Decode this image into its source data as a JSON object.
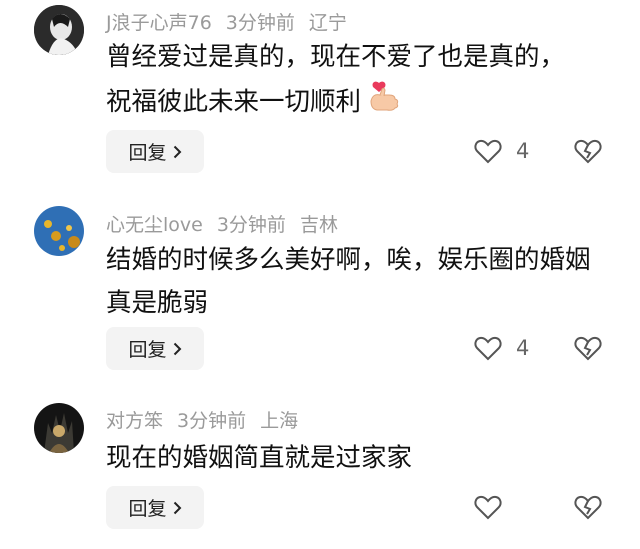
{
  "comments": [
    {
      "username": "J浪子心声76",
      "time": "3分钟前",
      "location": "辽宁",
      "text": "曾经爱过是真的，现在不爱了也是真的，祝福彼此未来一切顺利",
      "reply_label": "回复",
      "likes": "4",
      "emoji": "finger-heart-emoji"
    },
    {
      "username": "心无尘love",
      "time": "3分钟前",
      "location": "吉林",
      "text": "结婚的时候多么美好啊，唉，娱乐圈的婚姻真是脆弱",
      "reply_label": "回复",
      "likes": "4"
    },
    {
      "username": "对方笨",
      "time": "3分钟前",
      "location": "上海",
      "text": "现在的婚姻简直就是过家家",
      "reply_label": "回复"
    }
  ],
  "icons": {
    "like": "heart-outline-icon",
    "dislike": "broken-heart-icon",
    "reply_arrow": "chevron-right-icon"
  },
  "colors": {
    "meta_text": "#9a9a9a",
    "button_bg": "#f3f3f3",
    "icon_stroke": "#555555"
  }
}
